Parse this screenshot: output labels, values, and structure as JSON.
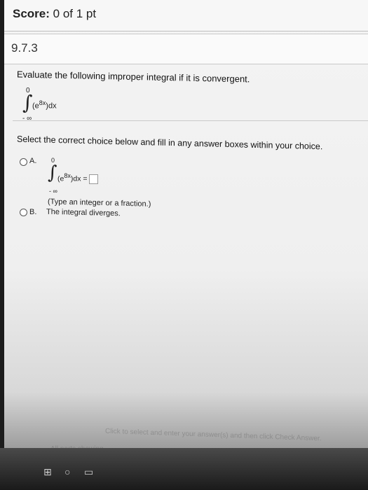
{
  "score": {
    "label": "Score:",
    "value": "0 of 1 pt"
  },
  "question_id": "9.7.3",
  "prompt": "Evaluate the following improper integral if it is convergent.",
  "integral": {
    "upper": "0",
    "lower": "- ∞",
    "integrand_open": "(e",
    "exponent": "8x",
    "integrand_close": ")dx"
  },
  "instruction": "Select the correct choice below and fill in any answer boxes within your choice.",
  "choices": {
    "a": {
      "label": "A.",
      "upper": "0",
      "lower": "- ∞",
      "integrand_open": "(e",
      "exponent": "8x",
      "integrand_close": ")dx =",
      "hint": "(Type an integer or a fraction.)"
    },
    "b": {
      "label": "B.",
      "text": "The integral diverges."
    }
  },
  "footer": {
    "line1": "Click to select and enter your answer(s) and then click Check Answer.",
    "line2": "All parts showing"
  }
}
